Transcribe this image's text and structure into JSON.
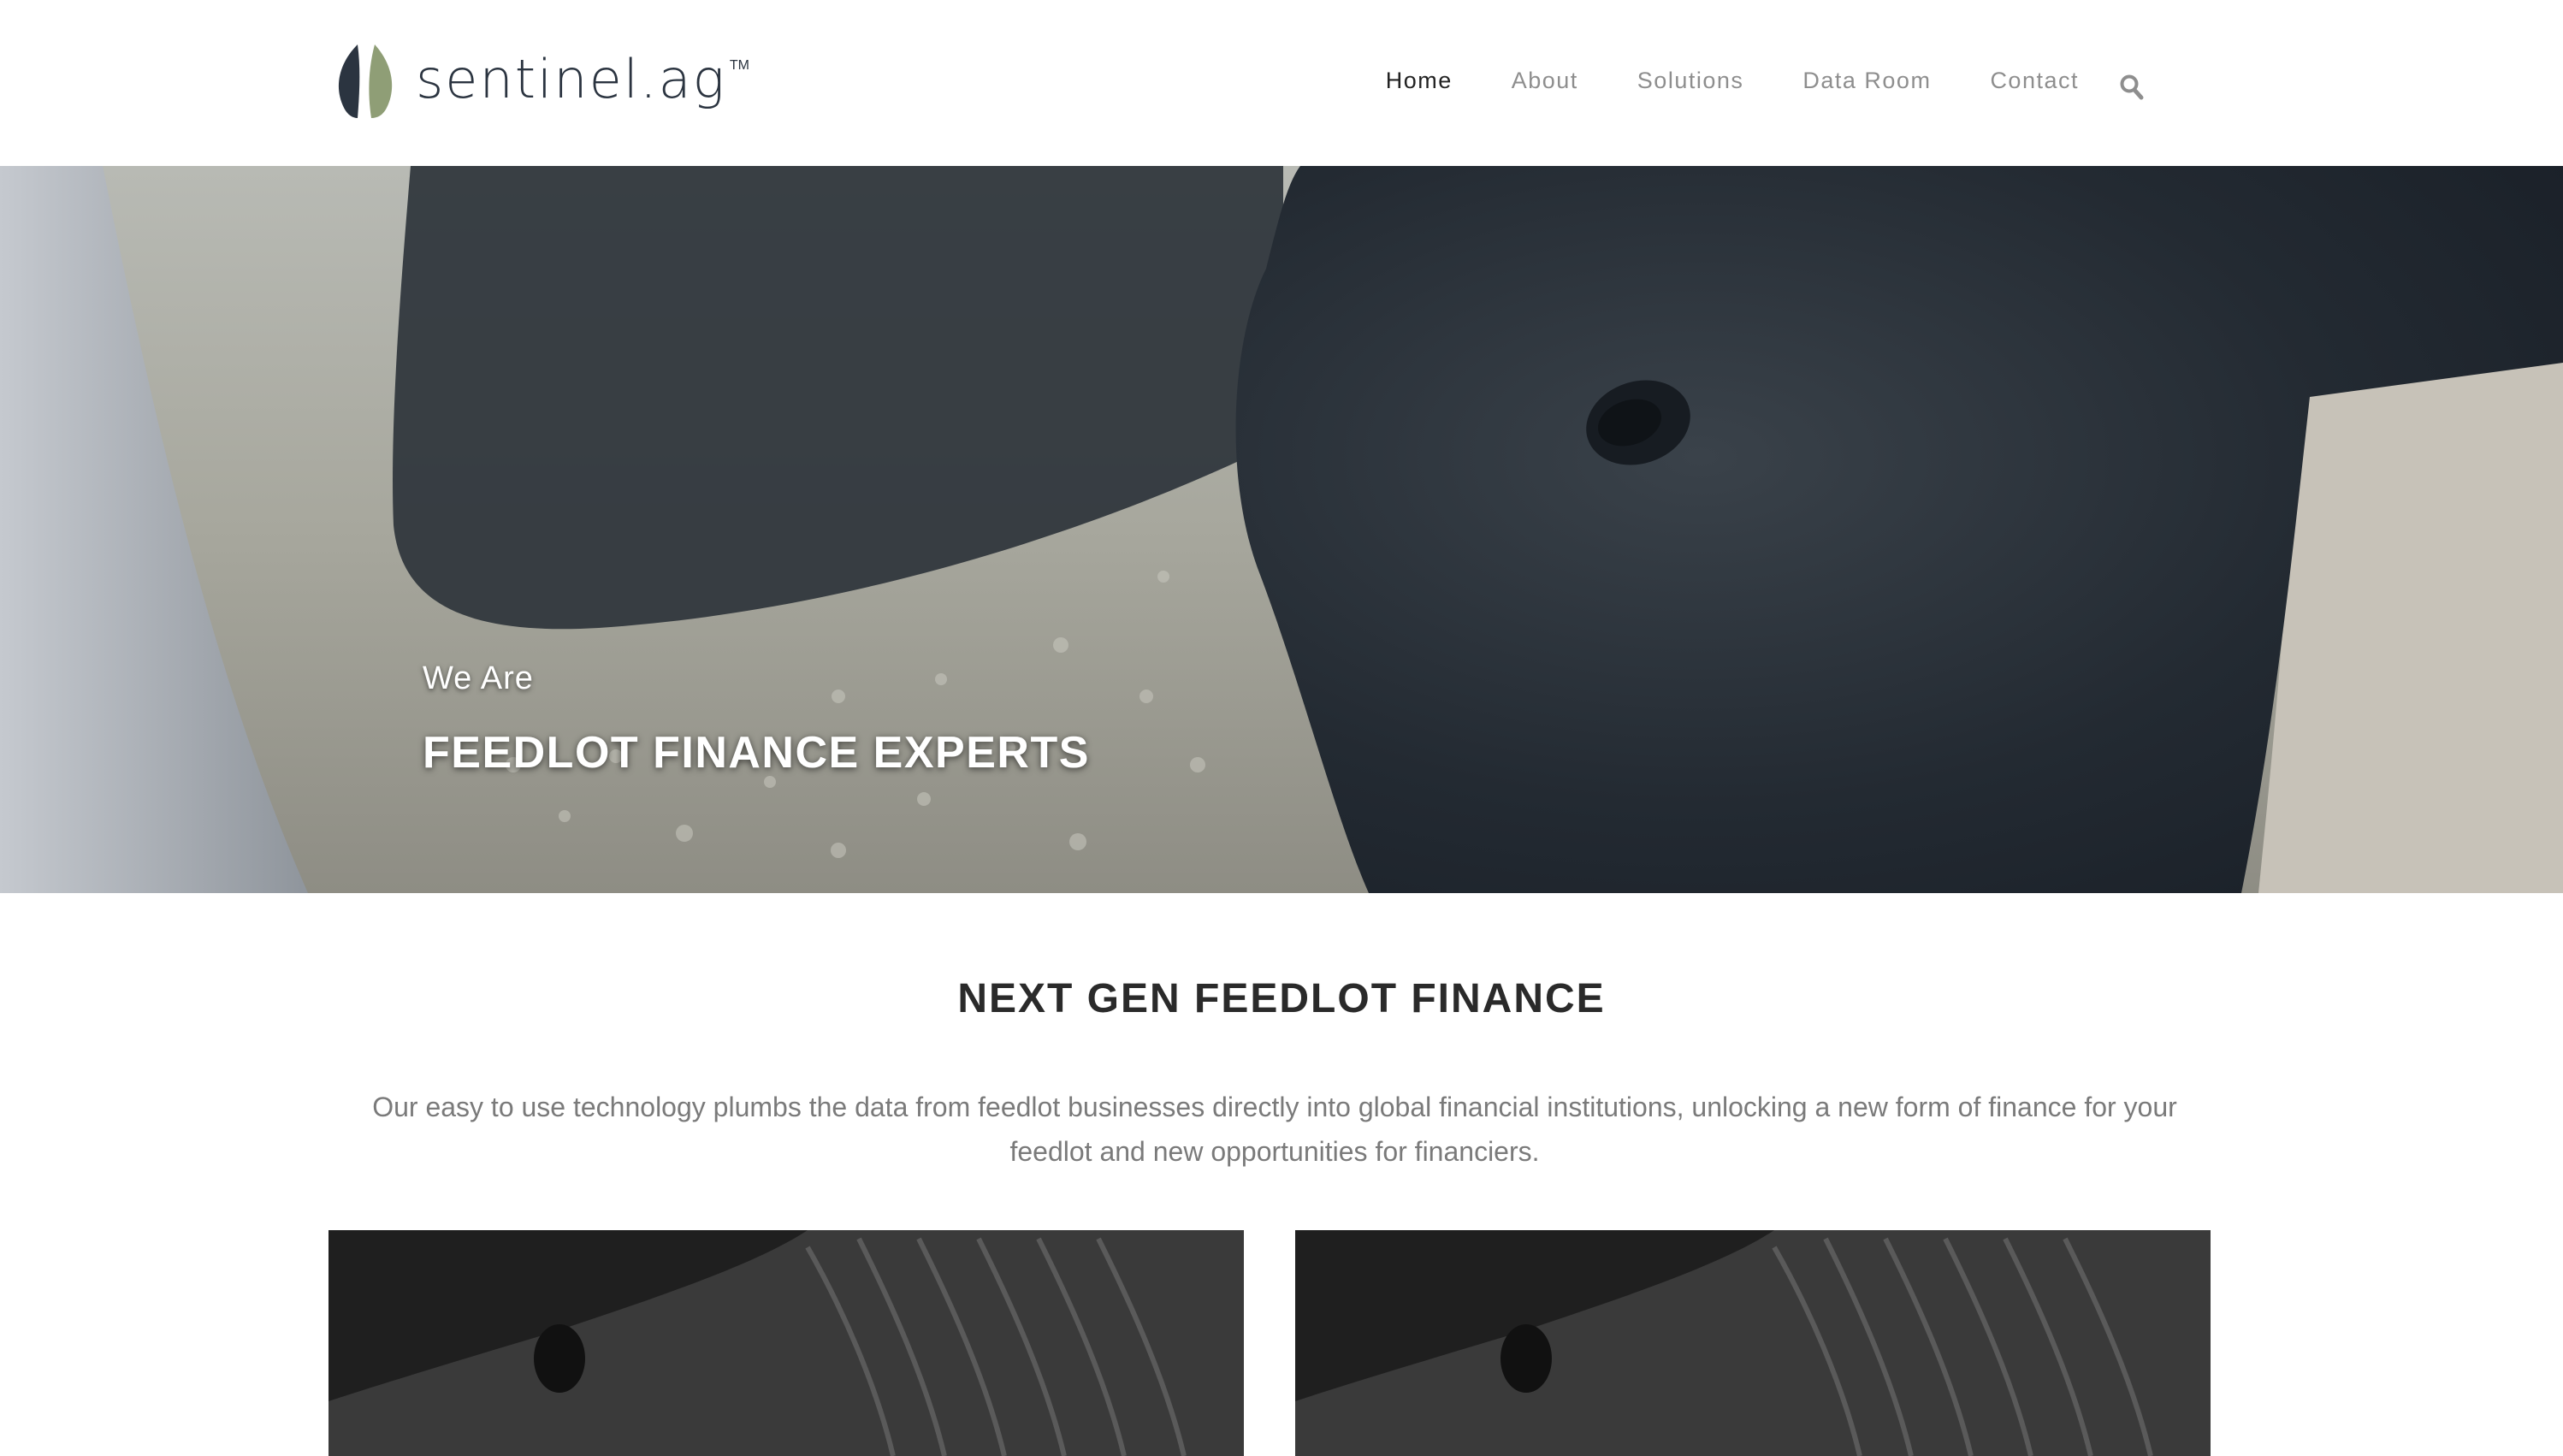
{
  "brand": {
    "name": "sentinel.ag",
    "trademark": "TM",
    "colors": {
      "dark": "#2b3440",
      "green": "#8f9e76"
    }
  },
  "nav": {
    "items": [
      {
        "label": "Home",
        "active": true
      },
      {
        "label": "About",
        "active": false
      },
      {
        "label": "Solutions",
        "active": false
      },
      {
        "label": "Data Room",
        "active": false
      },
      {
        "label": "Contact",
        "active": false
      }
    ],
    "search_icon": "search-icon"
  },
  "hero": {
    "kicker": "We Are",
    "title": "FEEDLOT FINANCE EXPERTS",
    "image": "cattle-feeding-photo"
  },
  "intro": {
    "title": "NEXT GEN FEEDLOT FINANCE",
    "body": "Our easy to use technology plumbs the data from feedlot businesses directly into global financial institutions, unlocking a new form of finance for your feedlot and new opportunities for financiers."
  },
  "cards": [
    {
      "image": "cattle-closeup-photo"
    },
    {
      "image": "cattle-closeup-photo"
    }
  ]
}
